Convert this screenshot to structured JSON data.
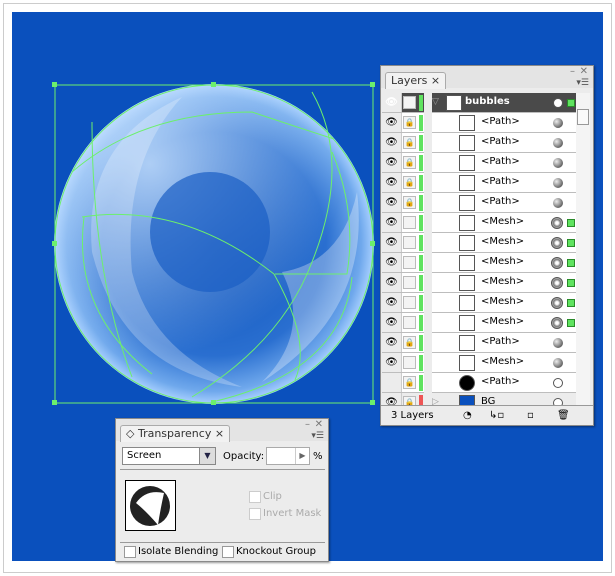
{
  "colors": {
    "canvas": "#0a50bd",
    "selection": "#6cf06c",
    "layer_bubbles": "#5fe35f",
    "layer_bg": "#e55555"
  },
  "layers_panel": {
    "tab_label": "Layers",
    "close": "×",
    "minimize": "–",
    "rows": [
      {
        "name": "bubbles",
        "type": "layer",
        "visible": true,
        "locked": false,
        "expanded": true,
        "selected": true
      },
      {
        "name": "<Path>",
        "visible": true,
        "locked": true,
        "target": "path"
      },
      {
        "name": "<Path>",
        "visible": true,
        "locked": true,
        "target": "path"
      },
      {
        "name": "<Path>",
        "visible": true,
        "locked": true,
        "target": "path"
      },
      {
        "name": "<Path>",
        "visible": true,
        "locked": true,
        "target": "path"
      },
      {
        "name": "<Path>",
        "visible": true,
        "locked": true,
        "target": "path"
      },
      {
        "name": "<Mesh>",
        "visible": true,
        "locked": false,
        "target": "mesh",
        "selected": true
      },
      {
        "name": "<Mesh>",
        "visible": true,
        "locked": false,
        "target": "mesh",
        "selected": true
      },
      {
        "name": "<Mesh>",
        "visible": true,
        "locked": false,
        "target": "mesh",
        "selected": true
      },
      {
        "name": "<Mesh>",
        "visible": true,
        "locked": false,
        "target": "mesh",
        "selected": true
      },
      {
        "name": "<Mesh>",
        "visible": true,
        "locked": false,
        "target": "mesh",
        "selected": true
      },
      {
        "name": "<Mesh>",
        "visible": true,
        "locked": false,
        "target": "mesh",
        "selected": true
      },
      {
        "name": "<Path>",
        "visible": true,
        "locked": true,
        "target": "path"
      },
      {
        "name": "<Mesh>",
        "visible": true,
        "locked": false,
        "target": "path"
      },
      {
        "name": "<Path>",
        "visible": false,
        "locked": true,
        "target": "empty"
      },
      {
        "name": "BG",
        "type": "layer",
        "visible": true,
        "locked": true,
        "expanded": false,
        "target": "empty"
      }
    ],
    "footer": {
      "count": "3 Layers"
    }
  },
  "transparency_panel": {
    "tab_label": "Transparency",
    "close": "×",
    "minimize": "–",
    "blend_mode": "Screen",
    "opacity_label": "Opacity:",
    "opacity_value": "",
    "percent": "%",
    "clip_label": "Clip",
    "invert_mask_label": "Invert Mask",
    "isolate_label": "Isolate Blending",
    "knockout_label": "Knockout Group"
  }
}
